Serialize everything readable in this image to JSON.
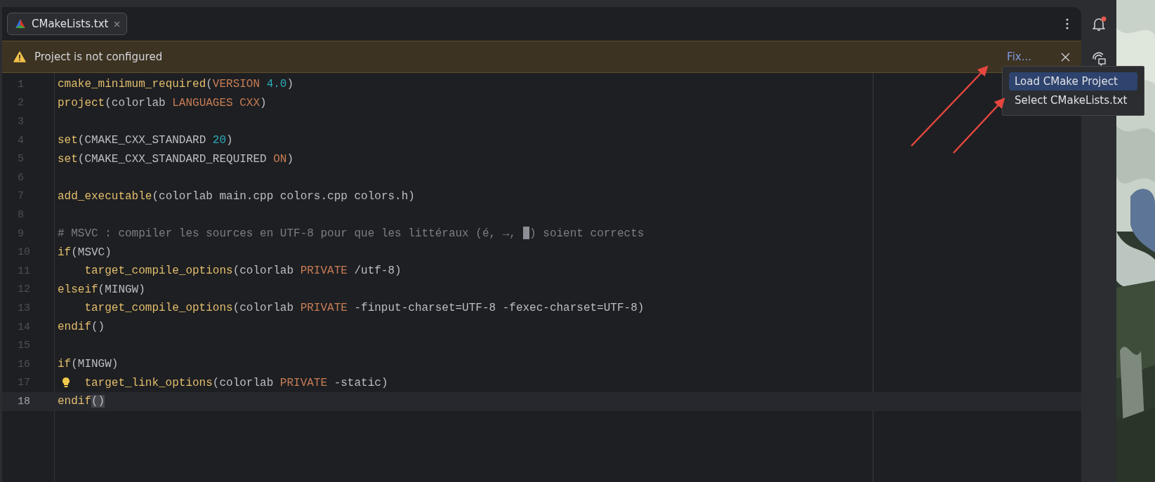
{
  "tab": {
    "title": "CMakeLists.txt",
    "selected": true
  },
  "banner": {
    "message": "Project is not configured",
    "action": "Fix..."
  },
  "popup_menu": [
    {
      "label": "Load CMake Project",
      "selected": true
    },
    {
      "label": "Select CMakeLists.txt",
      "selected": false
    }
  ],
  "editor": {
    "lines": [
      {
        "number": "1",
        "current": false,
        "tokens": [
          {
            "kind": "fn",
            "text": "cmake_minimum_required"
          },
          {
            "kind": "plain",
            "text": "("
          },
          {
            "kind": "kw",
            "text": "VERSION "
          },
          {
            "kind": "num",
            "text": "4.0"
          },
          {
            "kind": "plain",
            "text": ")"
          }
        ]
      },
      {
        "number": "2",
        "current": false,
        "tokens": [
          {
            "kind": "fn",
            "text": "project"
          },
          {
            "kind": "plain",
            "text": "(colorlab "
          },
          {
            "kind": "kw",
            "text": "LANGUAGES CXX"
          },
          {
            "kind": "plain",
            "text": ")"
          }
        ]
      },
      {
        "number": "3",
        "current": false
      },
      {
        "number": "4",
        "current": false,
        "tokens": [
          {
            "kind": "fn",
            "text": "set"
          },
          {
            "kind": "plain",
            "text": "(CMAKE_CXX_STANDARD "
          },
          {
            "kind": "num",
            "text": "20"
          },
          {
            "kind": "plain",
            "text": ")"
          }
        ]
      },
      {
        "number": "5",
        "current": false,
        "tokens": [
          {
            "kind": "fn",
            "text": "set"
          },
          {
            "kind": "plain",
            "text": "(CMAKE_CXX_STANDARD_REQUIRED "
          },
          {
            "kind": "kw",
            "text": "ON"
          },
          {
            "kind": "plain",
            "text": ")"
          }
        ]
      },
      {
        "number": "6",
        "current": false
      },
      {
        "number": "7",
        "current": false,
        "tokens": [
          {
            "kind": "fn",
            "text": "add_executable"
          },
          {
            "kind": "plain",
            "text": "(colorlab main.cpp colors.cpp colors.h)"
          }
        ]
      },
      {
        "number": "8",
        "current": false
      },
      {
        "number": "9",
        "current": false,
        "tokens": [
          {
            "kind": "comment",
            "text": "# MSVC : compiler les sources en UTF-8 pour que les littéraux (é, →, "
          },
          {
            "kind": "missing_glyph"
          },
          {
            "kind": "comment",
            "text": ") soient corrects"
          }
        ]
      },
      {
        "number": "10",
        "current": false,
        "tokens": [
          {
            "kind": "fn",
            "text": "if"
          },
          {
            "kind": "plain",
            "text": "(MSVC)"
          }
        ]
      },
      {
        "number": "11",
        "current": false,
        "indent": true,
        "tokens": [
          {
            "kind": "fn",
            "text": "target_compile_options"
          },
          {
            "kind": "plain",
            "text": "(colorlab "
          },
          {
            "kind": "kw",
            "text": "PRIVATE"
          },
          {
            "kind": "plain",
            "text": " /utf-8)"
          }
        ]
      },
      {
        "number": "12",
        "current": false,
        "tokens": [
          {
            "kind": "fn",
            "text": "elseif"
          },
          {
            "kind": "plain",
            "text": "(MINGW)"
          }
        ]
      },
      {
        "number": "13",
        "current": false,
        "indent": true,
        "tokens": [
          {
            "kind": "fn",
            "text": "target_compile_options"
          },
          {
            "kind": "plain",
            "text": "(colorlab "
          },
          {
            "kind": "kw",
            "text": "PRIVATE"
          },
          {
            "kind": "plain",
            "text": " -finput-charset=UTF-8 -fexec-charset=UTF-8)"
          }
        ]
      },
      {
        "number": "14",
        "current": false,
        "tokens": [
          {
            "kind": "fn",
            "text": "endif"
          },
          {
            "kind": "plain",
            "text": "()"
          }
        ]
      },
      {
        "number": "15",
        "current": false
      },
      {
        "number": "16",
        "current": false,
        "tokens": [
          {
            "kind": "fn",
            "text": "if"
          },
          {
            "kind": "plain",
            "text": "(MINGW)"
          }
        ]
      },
      {
        "number": "17",
        "current": false,
        "intention_bulb": true,
        "indent": true,
        "tokens": [
          {
            "kind": "fn",
            "text": "target_link_options"
          },
          {
            "kind": "plain",
            "text": "(colorlab "
          },
          {
            "kind": "kw",
            "text": "PRIVATE"
          },
          {
            "kind": "plain",
            "text": " -static)"
          }
        ]
      },
      {
        "number": "18",
        "current": true,
        "tokens": [
          {
            "kind": "fn",
            "text": "endif"
          },
          {
            "kind": "match",
            "text": "()"
          }
        ]
      }
    ]
  },
  "sidebar": {
    "notifications_unread": true
  }
}
